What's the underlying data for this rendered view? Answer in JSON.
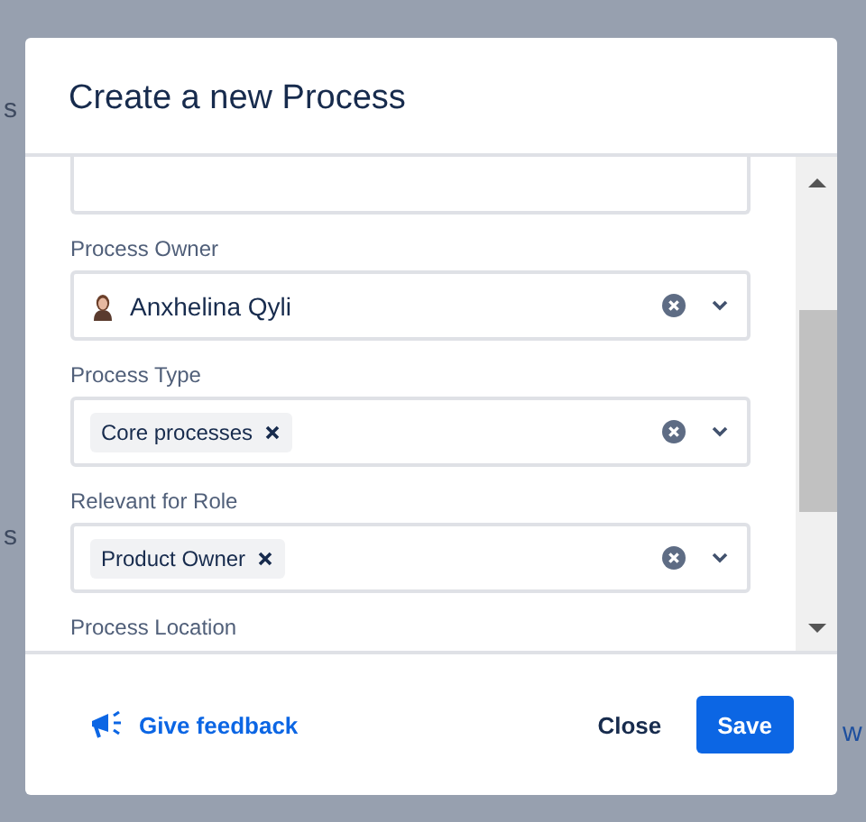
{
  "background": {
    "texts": [
      "s",
      "s",
      "w"
    ]
  },
  "dialog": {
    "title": "Create a new Process",
    "fields": [
      {
        "kind": "textarea"
      },
      {
        "kind": "user",
        "label": "Process Owner",
        "value": "Anxhelina Qyli"
      },
      {
        "kind": "tags",
        "label": "Process Type",
        "tags": [
          "Core processes"
        ]
      },
      {
        "kind": "tags",
        "label": "Relevant for Role",
        "tags": [
          "Product Owner"
        ]
      },
      {
        "kind": "label",
        "label": "Process Location"
      }
    ],
    "feedback": "Give feedback",
    "buttons": [
      {
        "label": "Close",
        "kind": "subtle"
      },
      {
        "label": "Save",
        "kind": "primary"
      }
    ]
  }
}
